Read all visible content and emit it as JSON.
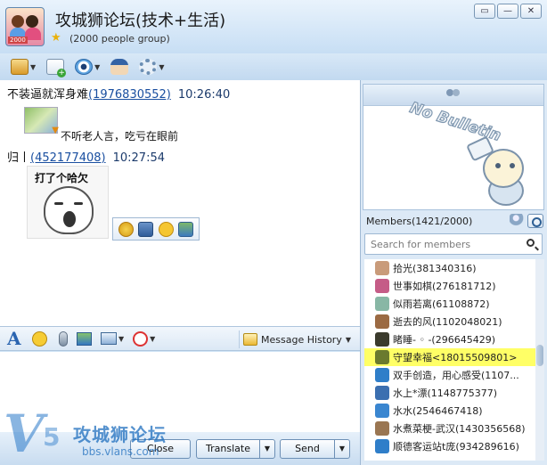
{
  "header": {
    "group_name": "攻城狮论坛(技术+生活)",
    "group_size": "(2000 people group)",
    "avatar_tag": "2000",
    "window_buttons": [
      "▭",
      "—",
      "✕"
    ]
  },
  "toolbar": {
    "icons": [
      "folder-share-icon",
      "new-note-icon",
      "camera-eye-icon",
      "admin-icon",
      "settings-gear-icon"
    ]
  },
  "chat": {
    "messages": [
      {
        "sender": "不装逼就浑身难",
        "qq": "(1976830552)",
        "time": "10:26:40",
        "text": "不听老人言，吃亏在眼前"
      },
      {
        "sender": "归丨",
        "qq": "(452177408)",
        "time": "10:27:54",
        "sticker_caption": "打了个哈欠"
      }
    ]
  },
  "input_toolbar": {
    "history_label": "Message History"
  },
  "bottom": {
    "close_label": "Close",
    "translate_label": "Translate",
    "send_label": "Send",
    "caret": "▼"
  },
  "watermark": {
    "brand_cn": "攻城狮论坛",
    "url": "bbs.vlans.com"
  },
  "bulletin": {
    "text": "No Bulletin"
  },
  "members": {
    "header": "Members(1421/2000)",
    "search_placeholder": "Search for members",
    "list": [
      {
        "name": "拾光(381340316)",
        "color": "#c99b7a"
      },
      {
        "name": "世事如棋(276181712)",
        "color": "#c55c87"
      },
      {
        "name": "似雨若离(61108872)",
        "color": "#88b7a5"
      },
      {
        "name": "逝去的风(1102048021)",
        "color": "#9b6a43"
      },
      {
        "name": "睹睡- ◦ -(296645429)",
        "color": "#3b3b2d"
      },
      {
        "name": "守望幸福<18015509801>",
        "color": "#6b7a2e",
        "highlight": true
      },
      {
        "name": "双手创造，用心感受(1107...",
        "color": "#2f7ec9"
      },
      {
        "name": "水上*漂(1148775377)",
        "color": "#3b6fb0"
      },
      {
        "name": "水水(2546467418)",
        "color": "#3a86d0"
      },
      {
        "name": "水煮菜梗-武汉(1430356568)",
        "color": "#9a7652"
      },
      {
        "name": "顺德客运站t庞(934289616)",
        "color": "#2f7ec9"
      }
    ]
  }
}
